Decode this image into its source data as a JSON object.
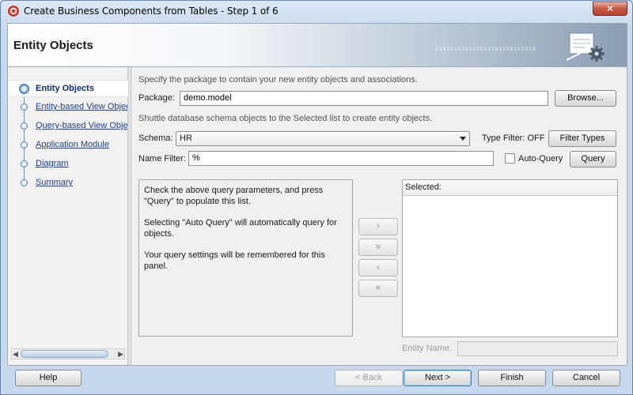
{
  "window": {
    "title": "Create Business Components from Tables - Step 1 of 6",
    "close_symbol": "✕"
  },
  "header": {
    "title": "Entity Objects",
    "binary_text": "010101010101010101010101010"
  },
  "nav": {
    "items": [
      {
        "label": "Entity Objects",
        "active": true
      },
      {
        "label": "Entity-based View Objects",
        "active": false
      },
      {
        "label": "Query-based View Objects",
        "active": false
      },
      {
        "label": "Application Module",
        "active": false
      },
      {
        "label": "Diagram",
        "active": false
      },
      {
        "label": "Summary",
        "active": false
      }
    ],
    "scroll_left": "◀",
    "scroll_right": "▶"
  },
  "form": {
    "package_instruction": "Specify the package to contain your new entity objects and associations.",
    "package_label": "Package:",
    "package_value": "demo.model",
    "browse_label": "Browse...",
    "shuttle_instruction": "Shuttle database schema objects to the Selected list to create entity objects.",
    "schema_label": "Schema:",
    "schema_value": "HR",
    "type_filter_label": "Type Filter: OFF",
    "filter_types_label": "Filter Types",
    "name_filter_label": "Name Filter:",
    "name_filter_value": "%",
    "auto_query_label": "Auto-Query",
    "auto_query_checked": false,
    "query_label": "Query"
  },
  "available": {
    "messages": [
      "Check the above query parameters, and press \"Query\" to populate this list.",
      "Selecting \"Auto Query\" will automatically query for objects.",
      "Your query settings will be remembered for this panel."
    ]
  },
  "shuttle": {
    "add": "›",
    "add_all": "»",
    "remove": "‹",
    "remove_all": "«"
  },
  "selected": {
    "header": "Selected:",
    "entity_name_label": "Entity Name:",
    "entity_name_value": ""
  },
  "footer": {
    "help": "Help",
    "back": "< Back",
    "next": "Next >",
    "finish": "Finish",
    "cancel": "Cancel"
  }
}
